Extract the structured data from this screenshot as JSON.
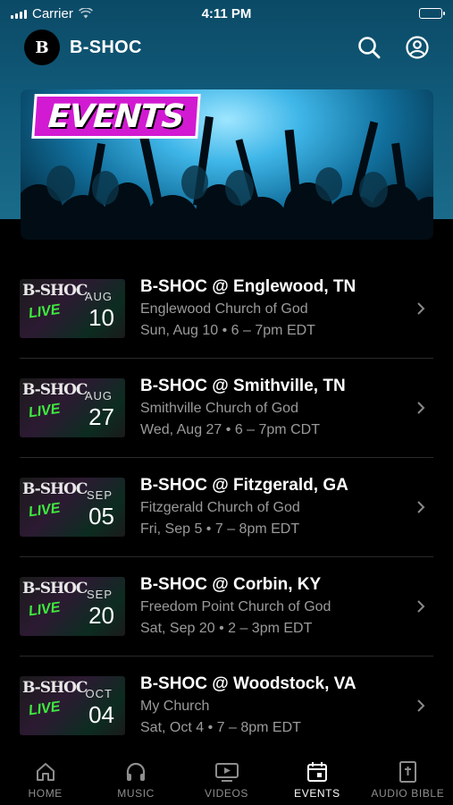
{
  "status_bar": {
    "carrier": "Carrier",
    "time": "4:11 PM"
  },
  "header": {
    "logo_text": "B",
    "title": "B-SHOC"
  },
  "hero": {
    "badge_text": "EVENTS"
  },
  "events": [
    {
      "thumb_logo": "B-SHOC",
      "thumb_live": "LIVE",
      "month": "AUG",
      "day": "10",
      "title": "B-SHOC @ Englewood, TN",
      "venue": "Englewood Church of God",
      "time": "Sun, Aug 10 • 6 – 7pm EDT"
    },
    {
      "thumb_logo": "B-SHOC",
      "thumb_live": "LIVE",
      "month": "AUG",
      "day": "27",
      "title": "B-SHOC @ Smithville, TN",
      "venue": "Smithville Church of God",
      "time": "Wed, Aug 27 • 6 – 7pm CDT"
    },
    {
      "thumb_logo": "B-SHOC",
      "thumb_live": "LIVE",
      "month": "SEP",
      "day": "05",
      "title": "B-SHOC @ Fitzgerald, GA",
      "venue": "Fitzgerald Church of God",
      "time": "Fri, Sep 5 • 7 – 8pm EDT"
    },
    {
      "thumb_logo": "B-SHOC",
      "thumb_live": "LIVE",
      "month": "SEP",
      "day": "20",
      "title": "B-SHOC @ Corbin, KY",
      "venue": "Freedom Point Church of God",
      "time": "Sat, Sep 20 • 2 – 3pm EDT"
    },
    {
      "thumb_logo": "B-SHOC",
      "thumb_live": "LIVE",
      "month": "OCT",
      "day": "04",
      "title": "B-SHOC @ Woodstock, VA",
      "venue": "My Church",
      "time": "Sat, Oct 4 • 7 – 8pm EDT"
    }
  ],
  "tabs": [
    {
      "label": "HOME",
      "icon": "home-icon",
      "active": false
    },
    {
      "label": "MUSIC",
      "icon": "headphones-icon",
      "active": false
    },
    {
      "label": "VIDEOS",
      "icon": "video-icon",
      "active": false
    },
    {
      "label": "EVENTS",
      "icon": "calendar-icon",
      "active": true
    },
    {
      "label": "AUDIO BIBLE",
      "icon": "bible-icon",
      "active": false
    }
  ],
  "colors": {
    "background": "#000000",
    "header_gradient": "#125e7e",
    "badge": "#d21ad2",
    "muted_text": "#9a9a9a",
    "live_green": "#3ee83e"
  }
}
